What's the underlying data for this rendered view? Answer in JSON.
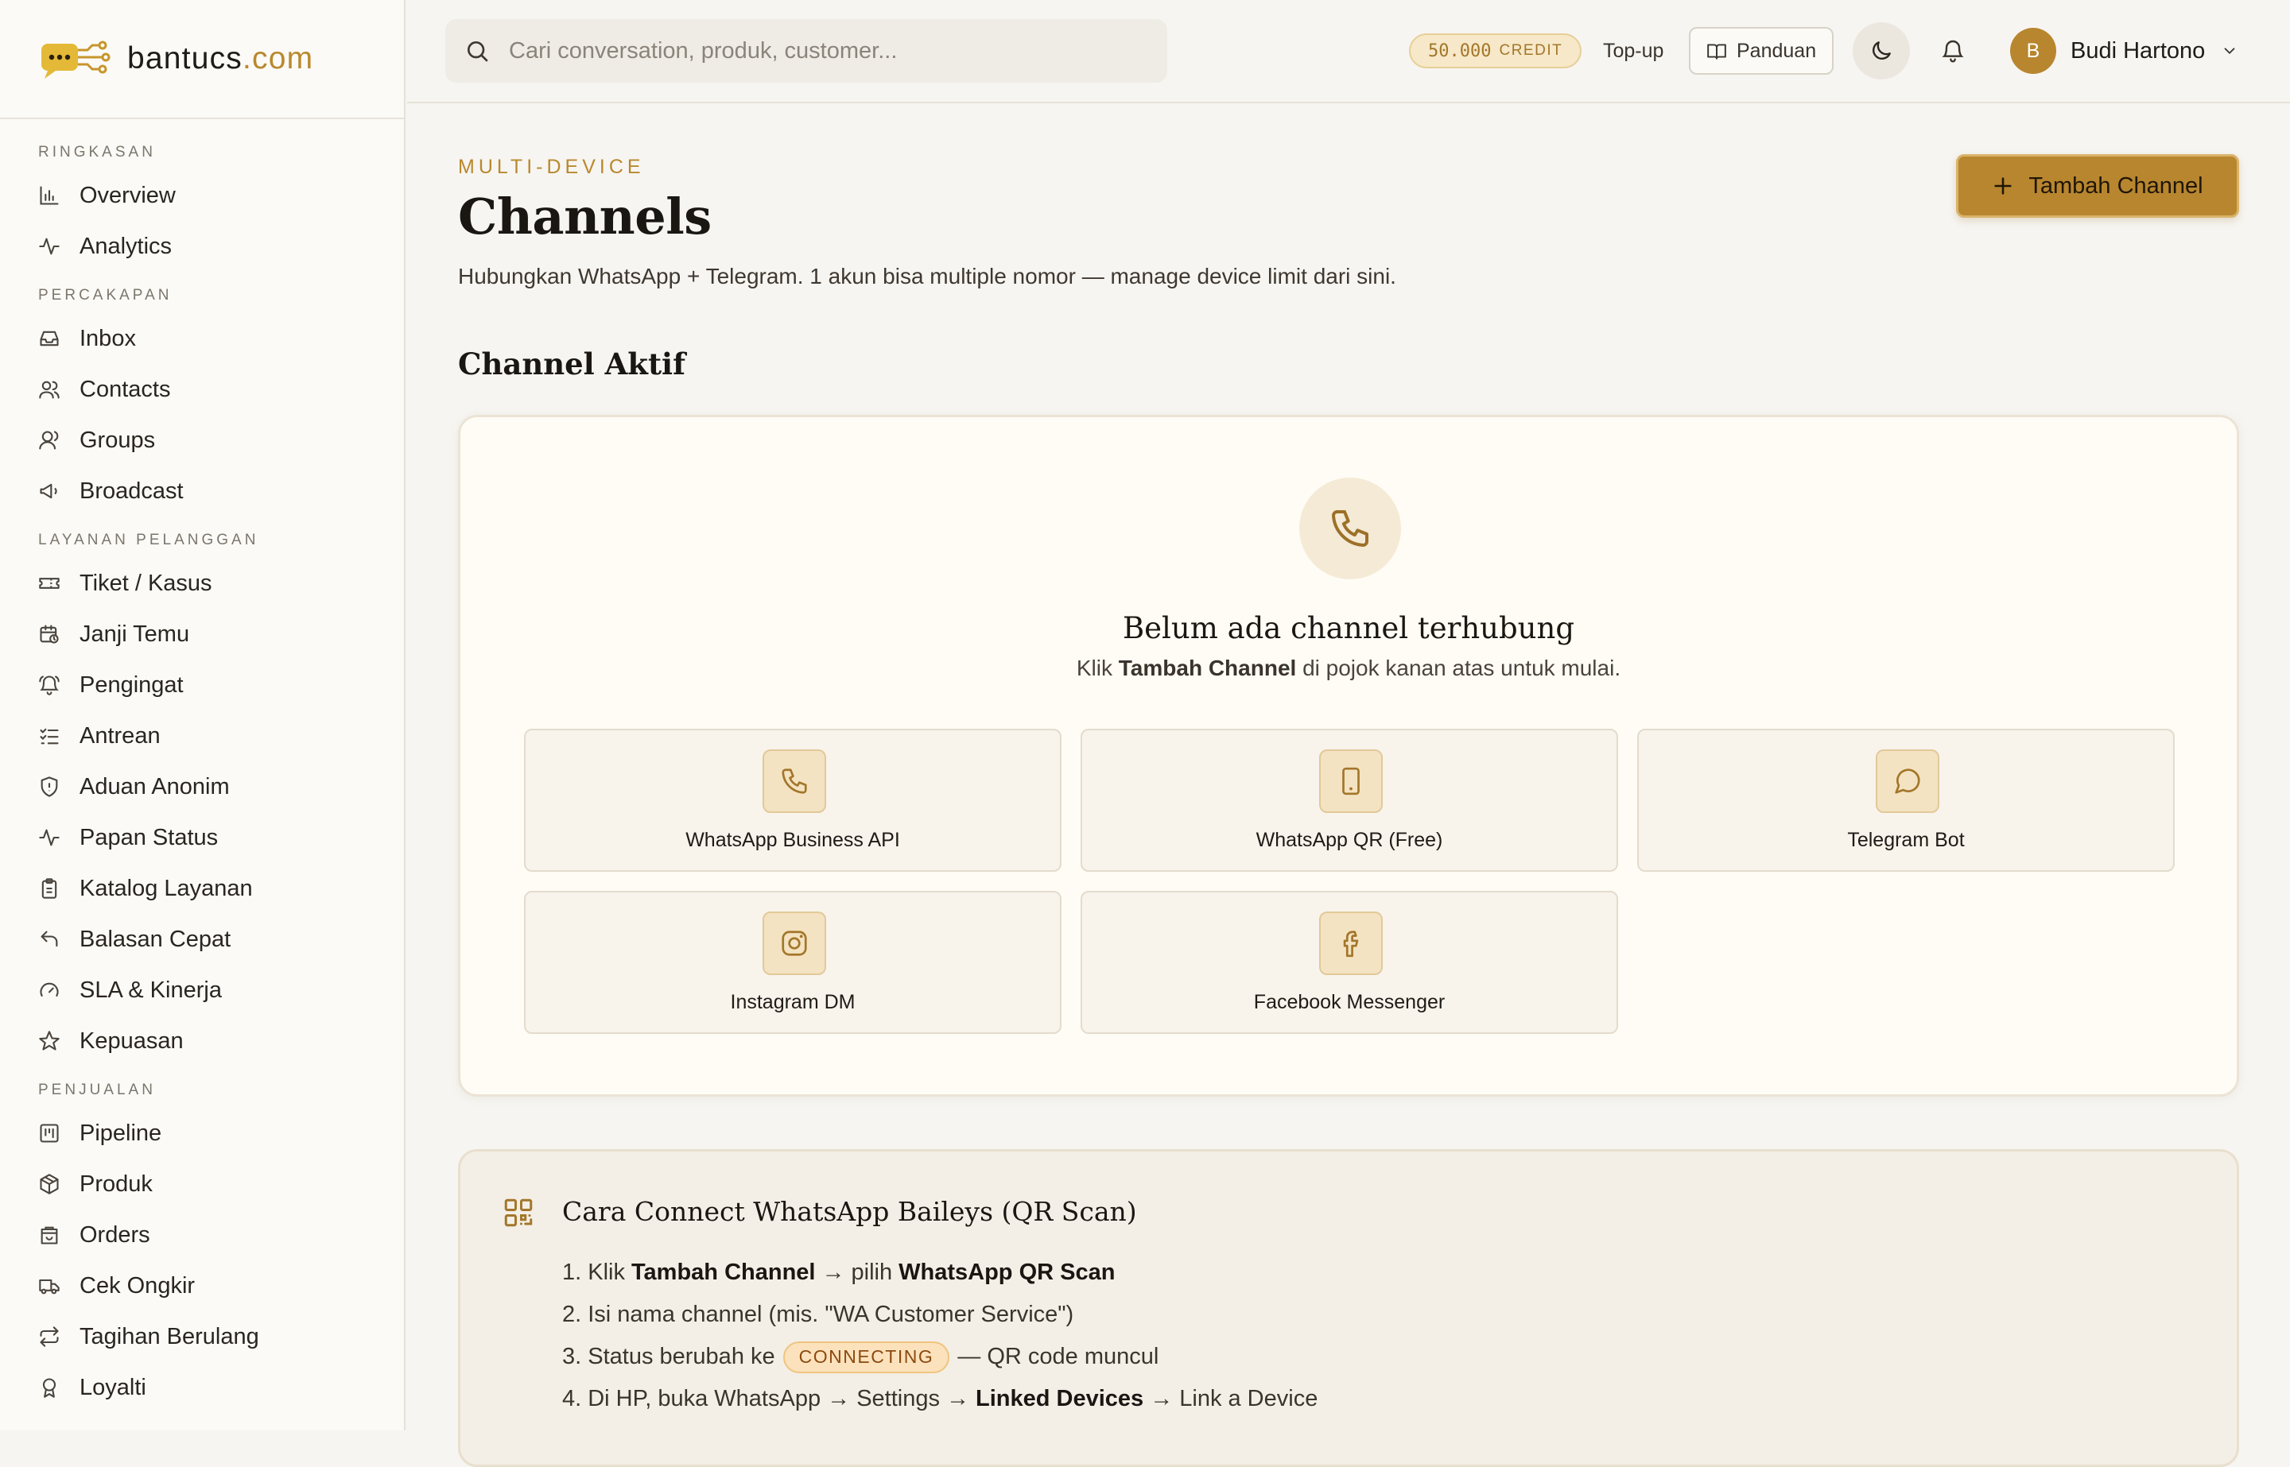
{
  "brand": {
    "name": "bantucs",
    "tld": ".com"
  },
  "sidebar": {
    "sections": [
      {
        "title": "RINGKASAN",
        "items": [
          {
            "label": "Overview",
            "icon": "bar-chart-icon"
          },
          {
            "label": "Analytics",
            "icon": "activity-icon"
          }
        ]
      },
      {
        "title": "PERCAKAPAN",
        "items": [
          {
            "label": "Inbox",
            "icon": "inbox-icon"
          },
          {
            "label": "Contacts",
            "icon": "users-icon"
          },
          {
            "label": "Groups",
            "icon": "user-group-icon"
          },
          {
            "label": "Broadcast",
            "icon": "megaphone-icon"
          }
        ]
      },
      {
        "title": "LAYANAN PELANGGAN",
        "items": [
          {
            "label": "Tiket / Kasus",
            "icon": "ticket-icon"
          },
          {
            "label": "Janji Temu",
            "icon": "calendar-clock-icon"
          },
          {
            "label": "Pengingat",
            "icon": "bell-ring-icon"
          },
          {
            "label": "Antrean",
            "icon": "list-checks-icon"
          },
          {
            "label": "Aduan Anonim",
            "icon": "shield-icon"
          },
          {
            "label": "Papan Status",
            "icon": "pulse-icon"
          },
          {
            "label": "Katalog Layanan",
            "icon": "clipboard-icon"
          },
          {
            "label": "Balasan Cepat",
            "icon": "reply-icon"
          },
          {
            "label": "SLA & Kinerja",
            "icon": "gauge-icon"
          },
          {
            "label": "Kepuasan",
            "icon": "star-icon"
          }
        ]
      },
      {
        "title": "PENJUALAN",
        "items": [
          {
            "label": "Pipeline",
            "icon": "kanban-icon"
          },
          {
            "label": "Produk",
            "icon": "package-icon"
          },
          {
            "label": "Orders",
            "icon": "shopping-bag-icon"
          },
          {
            "label": "Cek Ongkir",
            "icon": "truck-icon"
          },
          {
            "label": "Tagihan Berulang",
            "icon": "repeat-icon"
          },
          {
            "label": "Loyalti",
            "icon": "award-icon"
          }
        ]
      }
    ]
  },
  "topbar": {
    "search_placeholder": "Cari conversation, produk, customer...",
    "credit_amount": "50.000",
    "credit_label": "CREDIT",
    "topup_label": "Top-up",
    "panduan_label": "Panduan",
    "user_initial": "B",
    "user_name": "Budi Hartono"
  },
  "page": {
    "eyebrow": "MULTI-DEVICE",
    "title": "Channels",
    "description": "Hubungkan WhatsApp + Telegram. 1 akun bisa multiple nomor — manage device limit dari sini.",
    "add_button": "Tambah Channel",
    "section_title": "Channel Aktif"
  },
  "empty_state": {
    "title": "Belum ada channel terhubung",
    "desc_prefix": "Klik",
    "desc_bold": "Tambah Channel",
    "desc_suffix": "di pojok kanan atas untuk mulai."
  },
  "channel_types": [
    {
      "label": "WhatsApp Business API",
      "icon": "phone-icon"
    },
    {
      "label": "WhatsApp QR (Free)",
      "icon": "smartphone-icon"
    },
    {
      "label": "Telegram Bot",
      "icon": "message-circle-icon"
    },
    {
      "label": "Instagram DM",
      "icon": "instagram-icon"
    },
    {
      "label": "Facebook Messenger",
      "icon": "facebook-icon"
    }
  ],
  "guide": {
    "title": "Cara Connect WhatsApp Baileys (QR Scan)",
    "step1": {
      "a": "1. Klik",
      "b1": "Tambah Channel",
      "c": "→ pilih",
      "b2": "WhatsApp QR Scan"
    },
    "step2": "2. Isi nama channel (mis. \"WA Customer Service\")",
    "step3": {
      "a": "3. Status berubah ke",
      "pill": "CONNECTING",
      "c": "— QR code muncul"
    },
    "step4": {
      "a": "4. Di HP, buka WhatsApp → Settings →",
      "b": "Linked Devices",
      "c": "→ Link a Device"
    }
  },
  "colors": {
    "accent": "#b8862f",
    "accent_text": "#b8892e",
    "background": "#f7f5f1",
    "card": "#fffcf5",
    "status_connecting_bg": "#fbe2bd"
  }
}
